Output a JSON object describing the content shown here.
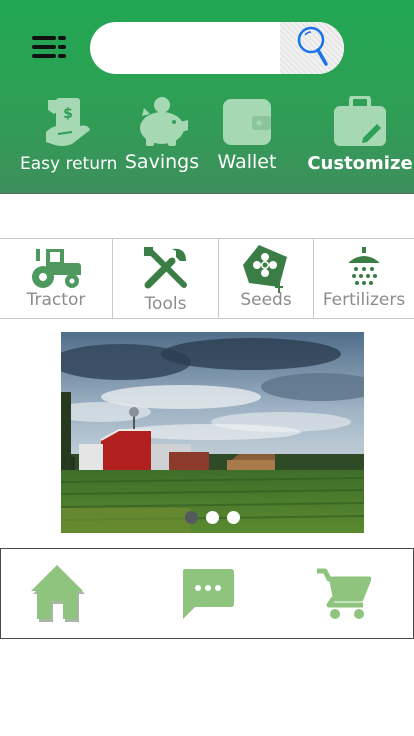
{
  "header": {
    "search": {
      "placeholder": "",
      "value": ""
    },
    "features": [
      {
        "label": "Easy return",
        "icon": "hand-money-icon"
      },
      {
        "label": "Savings",
        "icon": "piggy-bank-icon"
      },
      {
        "label": "Wallet",
        "icon": "wallet-icon"
      },
      {
        "label": "Customize",
        "icon": "briefcase-edit-icon"
      }
    ]
  },
  "categories": [
    {
      "label": "Tractor",
      "icon": "tractor-icon"
    },
    {
      "label": "Tools",
      "icon": "tools-icon"
    },
    {
      "label": "Seeds",
      "icon": "seeds-icon"
    },
    {
      "label": "Fertilizers",
      "icon": "fertilizer-shower-icon"
    }
  ],
  "carousel": {
    "slides": 3,
    "active_index": 0,
    "image": "farm-barn-field-photo"
  },
  "bottom_nav": [
    {
      "name": "home",
      "icon": "home-icon"
    },
    {
      "name": "chat",
      "icon": "chat-icon"
    },
    {
      "name": "cart",
      "icon": "cart-icon"
    }
  ],
  "colors": {
    "header_green": "#21a853",
    "icon_light_green": "#a6d8b4",
    "category_green": "#4e9a5e",
    "nav_green": "#8fc47e",
    "search_blue": "#1a73e8"
  }
}
